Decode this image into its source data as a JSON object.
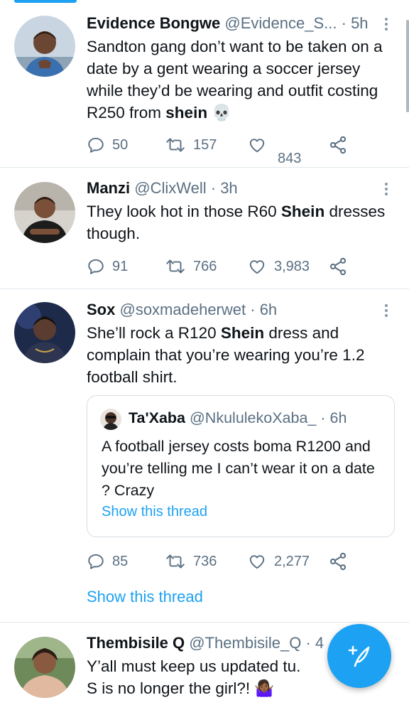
{
  "tweets": [
    {
      "name": "Evidence Bongwe",
      "handle": "@Evidence_S...",
      "time": "· 5h",
      "text_before": "Sandton gang don’t want to be taken on a date by a gent wearing a soccer jersey while they’d be wearing and outfit costing R250 from ",
      "text_bold": "shein",
      "text_after": " 💀",
      "replies": "50",
      "retweets": "157",
      "likes": "843"
    },
    {
      "name": "Manzi",
      "handle": "@ClixWell",
      "time": "· 3h",
      "text_before": "They look hot in those R60 ",
      "text_bold": "Shein",
      "text_after": " dresses though.",
      "replies": "91",
      "retweets": "766",
      "likes": "3,983"
    },
    {
      "name": "Sox",
      "handle": "@soxmadeherwet",
      "time": "· 6h",
      "text_before": "She’ll rock a R120 ",
      "text_bold": "Shein",
      "text_after": " dress and complain that you’re wearing you’re 1.2 football shirt.",
      "replies": "85",
      "retweets": "736",
      "likes": "2,277",
      "quote": {
        "name": "Ta'Xaba",
        "handle": "@NkululekoXaba_",
        "time": "· 6h",
        "text": "A football jersey costs boma R1200 and you’re telling me I can’t wear it on a date ? Crazy",
        "thread_link": "Show this thread"
      },
      "thread_link": "Show this thread"
    },
    {
      "name": "Thembisile Q",
      "handle": "@Thembisile_Q",
      "time": "· 4",
      "text": "Y’all must keep us updated tu.  S is no longer the girl?! 🤷🏾‍♀️"
    }
  ],
  "icons": {
    "reply": "reply-icon",
    "retweet": "retweet-icon",
    "like": "heart-icon",
    "share": "share-icon",
    "more": "more-options-icon",
    "compose": "compose-tweet-icon"
  },
  "colors": {
    "accent": "#1da1f2",
    "text": "#0f1419",
    "secondary": "#5b7083",
    "divider": "#e1e8ed"
  }
}
